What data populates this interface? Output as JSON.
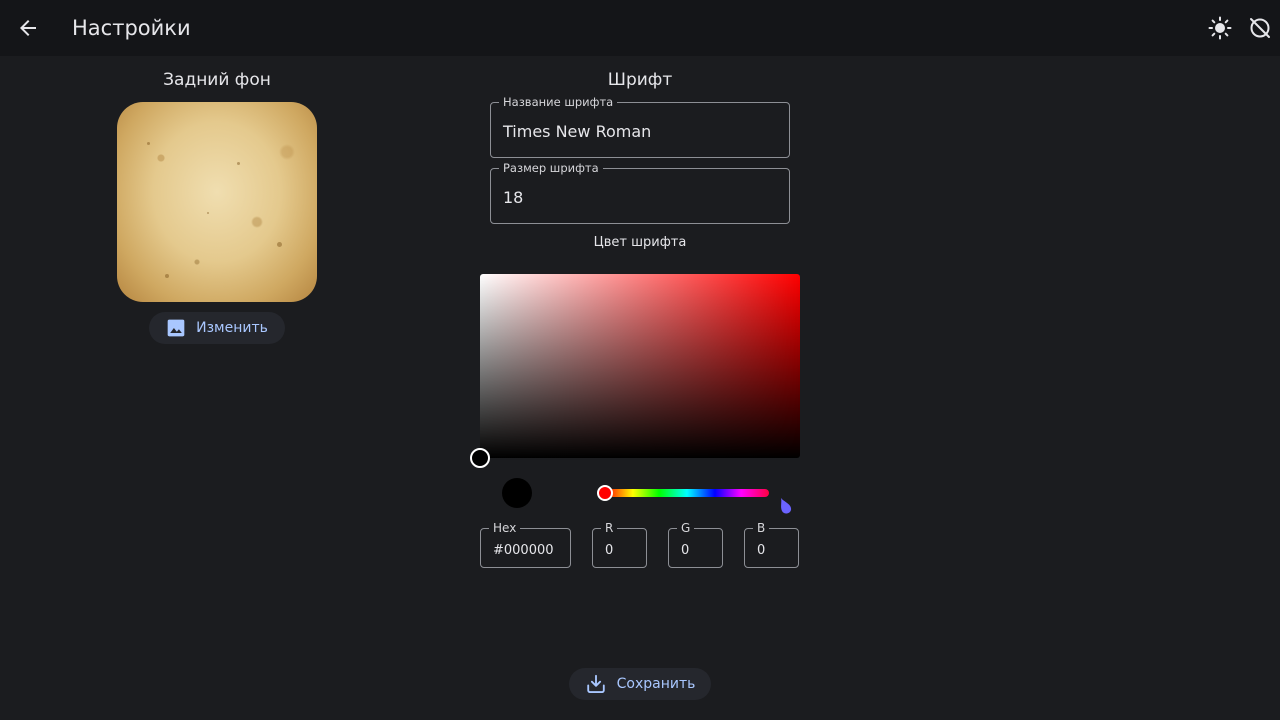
{
  "header": {
    "title": "Настройки",
    "icons": [
      "arrow-back-icon",
      "brightness-icon",
      "sync-disabled-icon"
    ]
  },
  "background_section": {
    "title": "Задний фон",
    "change_button_label": "Изменить"
  },
  "font_section": {
    "title": "Шрифт",
    "font_name_label": "Название шрифта",
    "font_name_value": "Times New Roman",
    "font_size_label": "Размер шрифта",
    "font_size_value": "18",
    "color_label": "Цвет шрифта"
  },
  "color_picker": {
    "hue": "#ff0000",
    "selected_color": "#000000",
    "hex_label": "Hex",
    "hex_value": "#000000",
    "r_label": "R",
    "r_value": "0",
    "g_label": "G",
    "g_value": "0",
    "b_label": "B",
    "b_value": "0"
  },
  "footer": {
    "save_label": "Сохранить"
  },
  "colors": {
    "background": "#1b1c1f",
    "appbar": "#141518",
    "accent": "#a9c7ff"
  }
}
